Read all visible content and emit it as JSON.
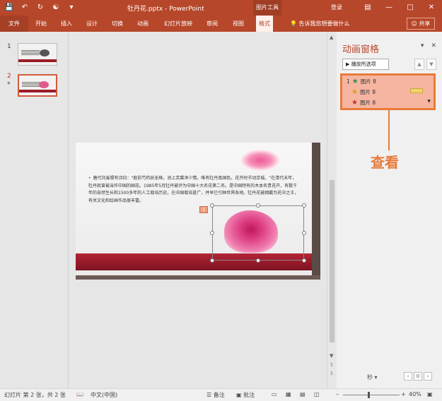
{
  "titlebar": {
    "title": "牡丹花.pptx - PowerPoint",
    "tools_tab": "图片工具",
    "login": "登录",
    "qat_icons": [
      "save-icon",
      "undo-icon",
      "redo-icon",
      "repeat-icon",
      "customize-icon"
    ],
    "window_buttons": [
      "restore-ribbon-icon",
      "minimize-icon",
      "maximize-icon",
      "close-icon"
    ]
  },
  "ribbon": {
    "tabs": [
      "文件",
      "开始",
      "插入",
      "设计",
      "切换",
      "动画",
      "幻灯片放映",
      "审阅",
      "视图",
      "格式"
    ],
    "tell_me": "告诉我您想要做什么",
    "share": "共享"
  },
  "thumbnails": {
    "items": [
      {
        "num": "1",
        "marker": ""
      },
      {
        "num": "2",
        "marker": "*"
      }
    ]
  },
  "slide": {
    "bullet": "•",
    "text": "唐代刘禹锡有诗曰：\"庭前芍药妖无格，池上芙蕖净少情。唯有牡丹真国色，花开时节动京城。\"在清代末年，牡丹就曾被当作中国的国花。1985年5月牡丹被评为中国十大名花第二名。是中国特有的木本名贵花卉，有数千年的自然生长和1500多年的人工栽培历史。在中国栽培甚广，并早已引种世界各地。牡丹花被拥戴为花中之王，有关文化和绘画作品很丰富。",
    "anim_tag": "1"
  },
  "pane": {
    "title": "动画窗格",
    "play_button": "播放所选项",
    "items": [
      {
        "order": "1",
        "label": "图片 8",
        "star_color": "#3a8a5a"
      },
      {
        "order": "",
        "label": "图片 8",
        "star_color": "#d8a020"
      },
      {
        "order": "",
        "label": "图片 8",
        "star_color": "#c0302a"
      }
    ],
    "seconds": "秒",
    "callout": "查看"
  },
  "status": {
    "slide_info": "幻灯片 第 2 张，共 2 张",
    "language": "中文(中国)",
    "notes": "备注",
    "comments": "批注",
    "zoom": "40%"
  },
  "colors": {
    "brand": "#b7472a",
    "callout": "#e87b3a",
    "slide_band": "#9b1c28"
  }
}
